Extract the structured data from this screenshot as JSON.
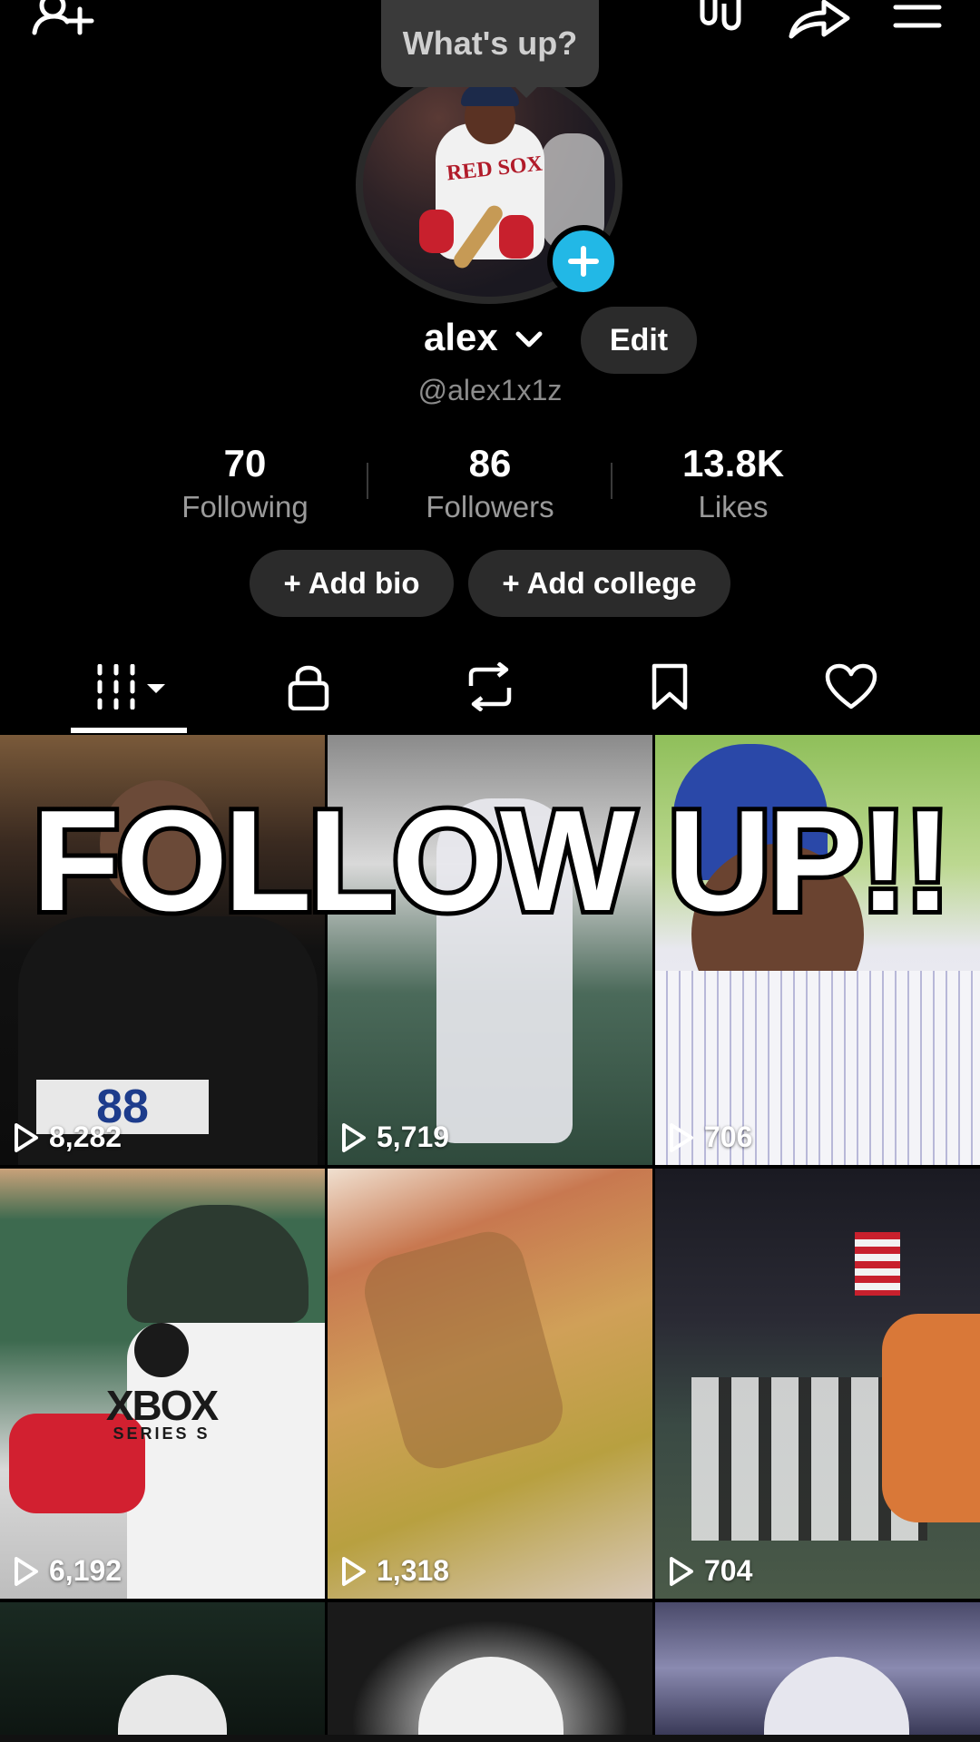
{
  "status_bubble": {
    "text": "What's up?"
  },
  "profile": {
    "display_name": "alex",
    "username": "@alex1x1z",
    "edit_label": "Edit",
    "avatar_text": "RED SOX"
  },
  "stats": [
    {
      "value": "70",
      "label": "Following"
    },
    {
      "value": "86",
      "label": "Followers"
    },
    {
      "value": "13.8K",
      "label": "Likes"
    }
  ],
  "actions": {
    "add_bio": "+ Add bio",
    "add_college": "+ Add college"
  },
  "tabs": [
    {
      "icon": "grid-icon",
      "active": true
    },
    {
      "icon": "lock-icon"
    },
    {
      "icon": "repost-icon"
    },
    {
      "icon": "bookmark-icon"
    },
    {
      "icon": "heart-icon"
    }
  ],
  "overlay": {
    "text": "FOLLOW UP!!"
  },
  "videos": [
    {
      "views": "8,282",
      "caption_badge": "88"
    },
    {
      "views": "5,719"
    },
    {
      "views": "706"
    },
    {
      "views": "6,192",
      "brand": "XBOX",
      "brand_sub": "SERIES S"
    },
    {
      "views": "1,318"
    },
    {
      "views": "704"
    }
  ],
  "colors": {
    "accent": "#22b8e6",
    "pill_bg": "#2b2b2b",
    "muted": "#9a9a9a"
  }
}
